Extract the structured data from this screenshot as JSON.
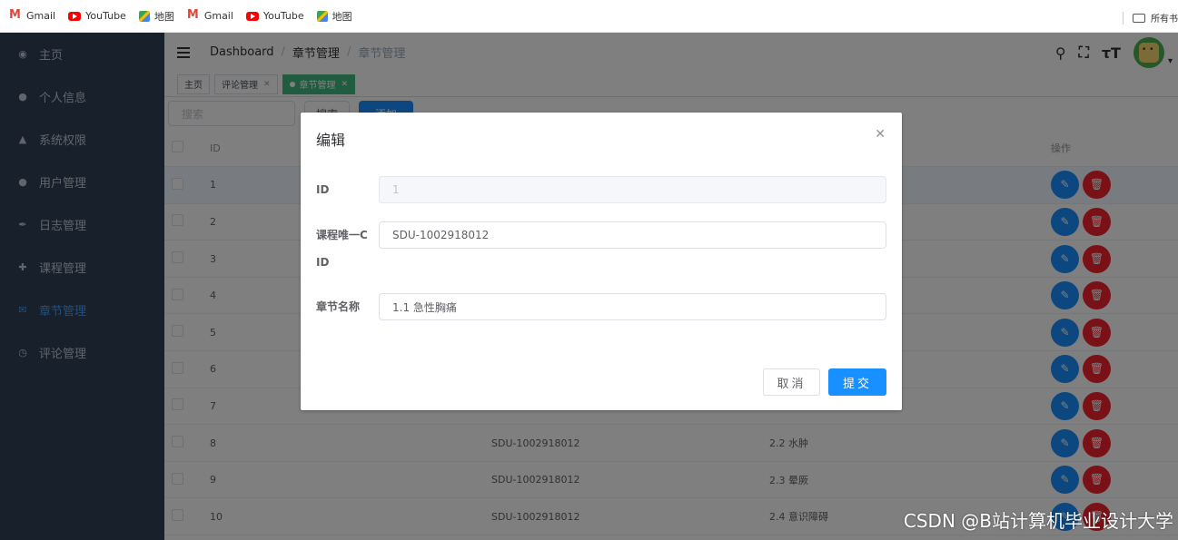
{
  "bookmarks": [
    {
      "label": "Gmail",
      "icon": "gmail-icon"
    },
    {
      "label": "YouTube",
      "icon": "youtube-icon"
    },
    {
      "label": "地图",
      "icon": "maps-icon"
    },
    {
      "label": "Gmail",
      "icon": "gmail-icon"
    },
    {
      "label": "YouTube",
      "icon": "youtube-icon"
    },
    {
      "label": "地图",
      "icon": "maps-icon"
    }
  ],
  "bookmarks_right": "所有书",
  "sidebar": {
    "items": [
      {
        "label": "主页",
        "icon": "dashboard-icon"
      },
      {
        "label": "个人信息",
        "icon": "user-icon"
      },
      {
        "label": "系统权限",
        "icon": "permission-icon"
      },
      {
        "label": "用户管理",
        "icon": "users-icon"
      },
      {
        "label": "日志管理",
        "icon": "log-icon"
      },
      {
        "label": "课程管理",
        "icon": "course-icon"
      },
      {
        "label": "章节管理",
        "icon": "mail-icon"
      },
      {
        "label": "评论管理",
        "icon": "comment-icon"
      }
    ],
    "active_index": 6
  },
  "breadcrumb": [
    "Dashboard",
    "章节管理",
    "章节管理"
  ],
  "tags": [
    {
      "label": "主页"
    },
    {
      "label": "评论管理"
    },
    {
      "label": "章节管理"
    }
  ],
  "toolbar": {
    "search_placeholder": "搜索",
    "search_button": "搜索",
    "add_button": "添加"
  },
  "table": {
    "headers": {
      "id": "ID",
      "ops": "操作"
    },
    "rows": [
      {
        "id": "1",
        "course": "",
        "name": ""
      },
      {
        "id": "2",
        "course": "",
        "name": ""
      },
      {
        "id": "3",
        "course": "",
        "name": ""
      },
      {
        "id": "4",
        "course": "",
        "name": ""
      },
      {
        "id": "5",
        "course": "",
        "name": ""
      },
      {
        "id": "6",
        "course": "",
        "name": ""
      },
      {
        "id": "7",
        "course": "",
        "name": ""
      },
      {
        "id": "8",
        "course": "SDU-1002918012",
        "name": "2.2 水肿"
      },
      {
        "id": "9",
        "course": "SDU-1002918012",
        "name": "2.3 晕厥"
      },
      {
        "id": "10",
        "course": "SDU-1002918012",
        "name": "2.4 意识障碍"
      }
    ]
  },
  "dialog": {
    "title": "编辑",
    "fields": {
      "id_label": "ID",
      "id_value": "1",
      "course_label_1": "课程唯一C",
      "course_label_2": "ID",
      "course_value": "SDU-1002918012",
      "name_label": "章节名称",
      "name_value": "1.1 急性胸痛"
    },
    "cancel": "取消",
    "submit": "提交"
  },
  "watermark": "CSDN @B站计算机毕业设计大学",
  "colors": {
    "sidebar_bg": "#304156",
    "primary": "#1890ff",
    "danger": "#f5222d",
    "tag_active": "#42b983"
  }
}
